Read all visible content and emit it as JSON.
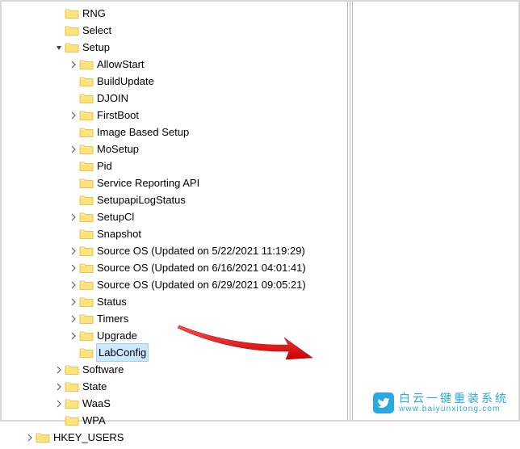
{
  "tree": {
    "siblingsBeforeSetup": [
      {
        "name": "RNG",
        "expand": "none"
      },
      {
        "name": "Select",
        "expand": "none"
      }
    ],
    "setup": {
      "name": "Setup",
      "children": [
        {
          "name": "AllowStart",
          "expand": "closed"
        },
        {
          "name": "BuildUpdate",
          "expand": "none"
        },
        {
          "name": "DJOIN",
          "expand": "none"
        },
        {
          "name": "FirstBoot",
          "expand": "closed"
        },
        {
          "name": "Image Based Setup",
          "expand": "none"
        },
        {
          "name": "MoSetup",
          "expand": "closed"
        },
        {
          "name": "Pid",
          "expand": "none"
        },
        {
          "name": "Service Reporting API",
          "expand": "none"
        },
        {
          "name": "SetupapiLogStatus",
          "expand": "none"
        },
        {
          "name": "SetupCl",
          "expand": "closed"
        },
        {
          "name": "Snapshot",
          "expand": "none"
        },
        {
          "name": "Source OS (Updated on 5/22/2021 11:19:29)",
          "expand": "closed"
        },
        {
          "name": "Source OS (Updated on 6/16/2021 04:01:41)",
          "expand": "closed"
        },
        {
          "name": "Source OS (Updated on 6/29/2021 09:05:21)",
          "expand": "closed"
        },
        {
          "name": "Status",
          "expand": "closed"
        },
        {
          "name": "Timers",
          "expand": "closed"
        },
        {
          "name": "Upgrade",
          "expand": "closed"
        },
        {
          "name": "LabConfig",
          "expand": "none",
          "selected": true
        }
      ]
    },
    "siblingsAfterSetup": [
      {
        "name": "Software",
        "expand": "closed"
      },
      {
        "name": "State",
        "expand": "closed"
      },
      {
        "name": "WaaS",
        "expand": "closed"
      },
      {
        "name": "WPA",
        "expand": "none"
      }
    ],
    "root": {
      "name": "HKEY_USERS",
      "expand": "closed"
    }
  },
  "watermark": {
    "brand": "白云一键重装系统",
    "url": "www.baiyunxitong.com"
  }
}
